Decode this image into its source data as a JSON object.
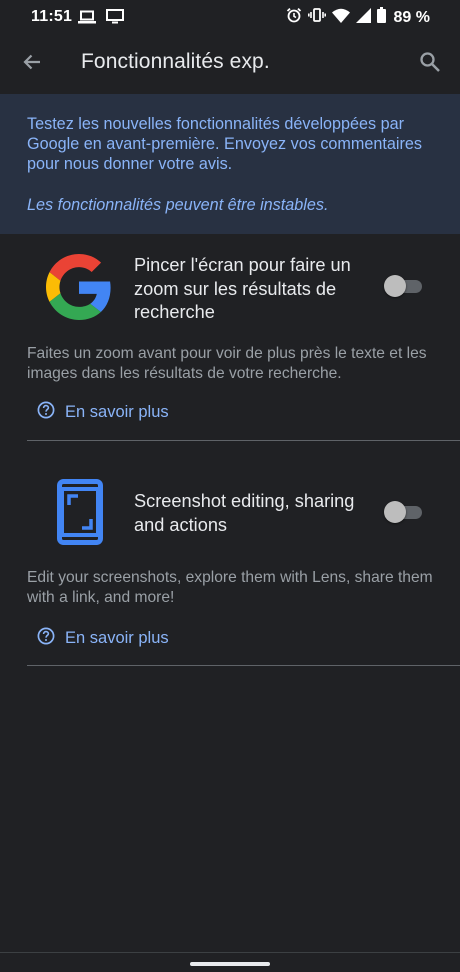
{
  "status_bar": {
    "time": "11:51",
    "battery": "89 %",
    "left_icons": [
      "laptop-icon",
      "monitor-icon"
    ],
    "right_icons": [
      "alarm-icon",
      "vibrate-icon",
      "wifi-icon",
      "signal-icon",
      "battery-icon"
    ]
  },
  "app_bar": {
    "title": "Fonctionnalités exp.",
    "back_icon": "arrow-left-icon",
    "search_icon": "search-icon"
  },
  "banner": {
    "text": "Testez les nouvelles fonctionnalités développées par Google en avant-première. Envoyez vos commentaires pour nous donner votre avis.",
    "warning": "Les fonctionnalités peuvent être instables."
  },
  "features": [
    {
      "title": "Pincer l'écran pour faire un zoom sur les résultats de recherche",
      "description": "Faites un zoom avant pour voir de plus près le texte et les images dans les résultats de votre recherche.",
      "learn_more": "En savoir plus",
      "icon": "google-g-icon",
      "enabled": false
    },
    {
      "title": "Screenshot editing, sharing and actions",
      "description": "Edit your screenshots, explore them with Lens, share them with a link, and more!",
      "learn_more": "En savoir plus",
      "icon": "screenshot-phone-icon",
      "enabled": false
    }
  ],
  "colors": {
    "background": "#202124",
    "banner": "#283142",
    "accent": "#8ab4f8",
    "text": "#e8eaed",
    "secondary_text": "#9aa0a6"
  }
}
